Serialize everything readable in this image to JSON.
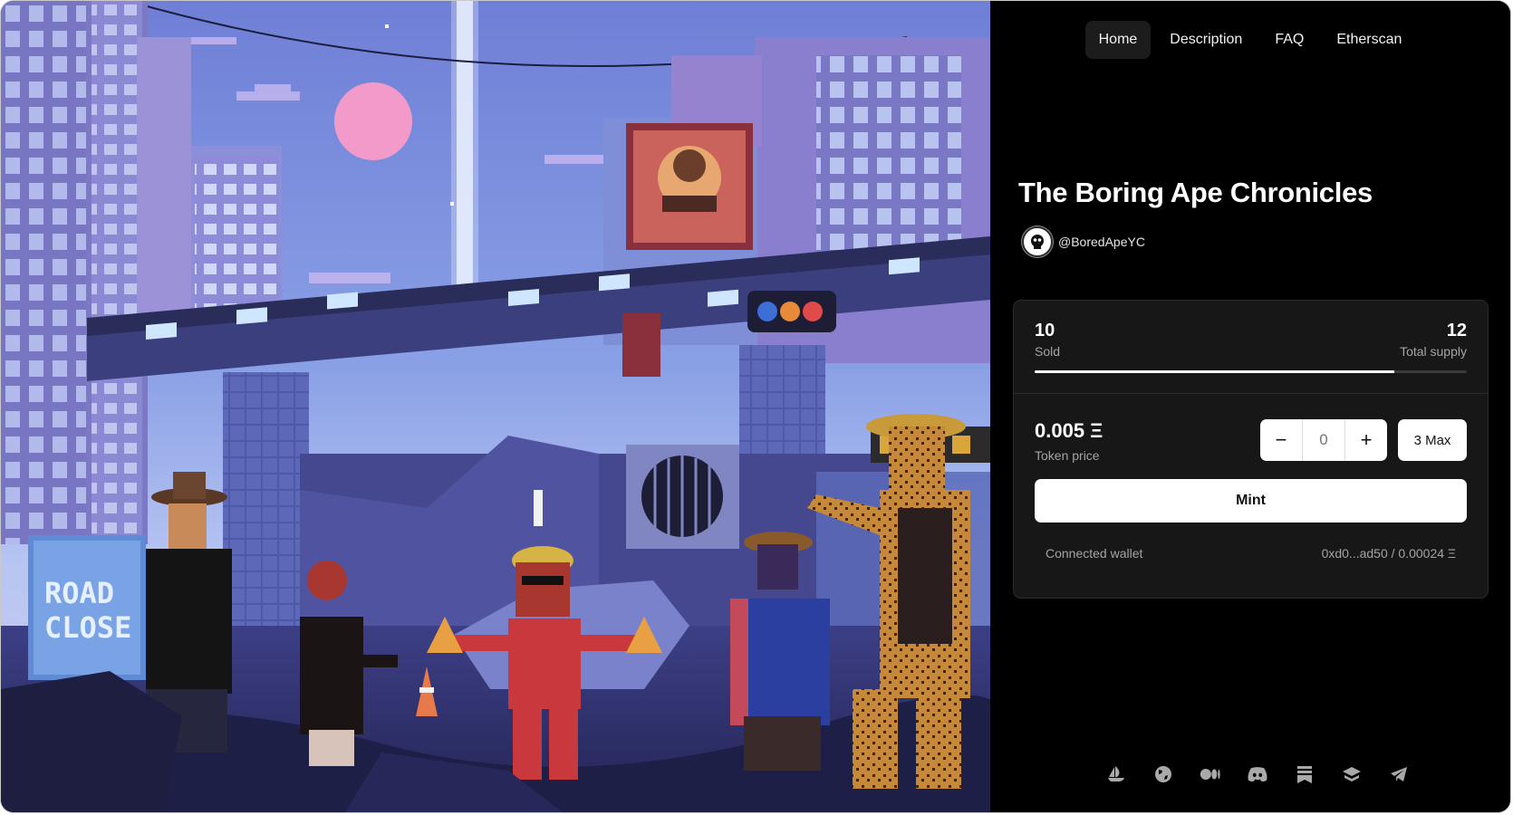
{
  "nav": {
    "items": [
      {
        "label": "Home",
        "active": true
      },
      {
        "label": "Description",
        "active": false
      },
      {
        "label": "FAQ",
        "active": false
      },
      {
        "label": "Etherscan",
        "active": false
      }
    ]
  },
  "collection": {
    "title": "The Boring Ape Chronicles",
    "author_handle": "@BoredApeYC",
    "artwork": {
      "sign_text": [
        "ROAD",
        "CLOSE"
      ]
    }
  },
  "mint": {
    "sold": "10",
    "sold_label": "Sold",
    "total_supply": "12",
    "total_supply_label": "Total supply",
    "progress_fraction": 0.833,
    "price": "0.005 Ξ",
    "price_label": "Token price",
    "quantity_placeholder": "0",
    "decrement_symbol": "−",
    "increment_symbol": "+",
    "max_label": "3 Max",
    "mint_label": "Mint",
    "wallet_label": "Connected wallet",
    "wallet_value": "0xd0...ad50 / 0.00024 Ξ"
  },
  "socials": [
    {
      "icon": "opensea-icon"
    },
    {
      "icon": "globe-icon"
    },
    {
      "icon": "medium-icon"
    },
    {
      "icon": "discord-icon"
    },
    {
      "icon": "bookmark-icon"
    },
    {
      "icon": "layers-icon"
    },
    {
      "icon": "telegram-icon"
    }
  ],
  "colors": {
    "panel_bg": "#000000",
    "card_bg": "#171717",
    "accent": "#ffffff",
    "muted_text": "#a4a4a4"
  }
}
